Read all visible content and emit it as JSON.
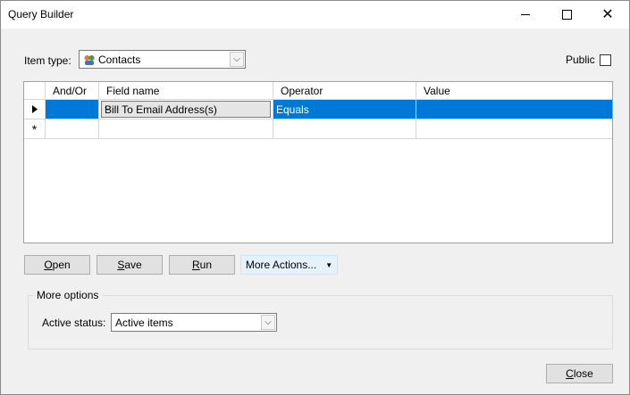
{
  "window": {
    "title": "Query Builder"
  },
  "form": {
    "item_type_label": "Item type:",
    "item_type_value": "Contacts",
    "public_label": "Public"
  },
  "grid": {
    "columns": [
      "And/Or",
      "Field name",
      "Operator",
      "Value"
    ],
    "rows": [
      {
        "and_or": "",
        "field": "Bill To Email Address(s)",
        "operator": "Equals",
        "value": ""
      }
    ],
    "new_row_marker": "*"
  },
  "buttons": {
    "open": "Open",
    "save": "Save",
    "run": "Run",
    "more_actions": "More Actions...",
    "close": "Close"
  },
  "more_options": {
    "legend": "More options",
    "active_status_label": "Active status:",
    "active_status_value": "Active items"
  },
  "colors": {
    "selection": "#0078d7",
    "window_bg": "#f0f0f0"
  }
}
